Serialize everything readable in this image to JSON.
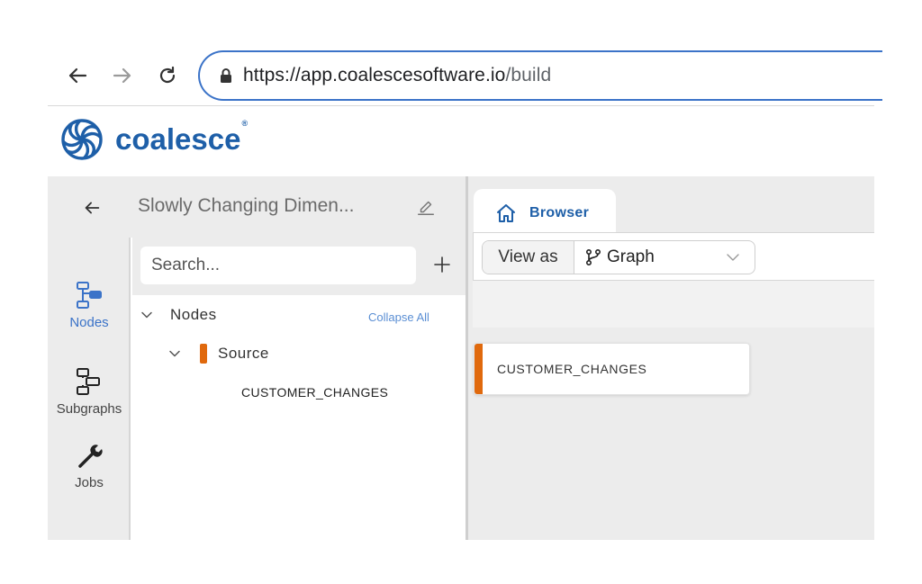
{
  "browser": {
    "url_base": "https://app.coalescesoftware.io",
    "url_path": "/build",
    "icons": [
      "back-arrow-icon",
      "forward-arrow-icon",
      "reload-icon",
      "lock-icon"
    ]
  },
  "brand": {
    "name": "coalesce",
    "registered": "®",
    "color": "#1e5fa8"
  },
  "header": {
    "project_title": "Slowly Changing Dimen...",
    "icons": [
      "back-arrow-icon",
      "edit-pencil-icon"
    ]
  },
  "rail": {
    "items": [
      {
        "label": "Nodes",
        "icon": "nodes-icon",
        "active": true
      },
      {
        "label": "Subgraphs",
        "icon": "subgraphs-icon",
        "active": false
      },
      {
        "label": "Jobs",
        "icon": "wrench-icon",
        "active": false
      }
    ]
  },
  "tree": {
    "search_placeholder": "Search...",
    "root_label": "Nodes",
    "collapse_all": "Collapse All",
    "group_label": "Source",
    "group_color": "#e0690d",
    "leaf_label": "CUSTOMER_CHANGES"
  },
  "browser_tab": {
    "label": "Browser",
    "icon": "home-icon"
  },
  "toolbar": {
    "view_as_label": "View as",
    "view_as_value": "Graph",
    "icons": [
      "branch-icon",
      "chevron-down-icon"
    ]
  },
  "graph": {
    "node_label": "CUSTOMER_CHANGES",
    "node_color": "#e0690d"
  },
  "colors": {
    "accent": "#3b73c8",
    "panel_bg": "#ececec",
    "source_orange": "#e0690d"
  }
}
